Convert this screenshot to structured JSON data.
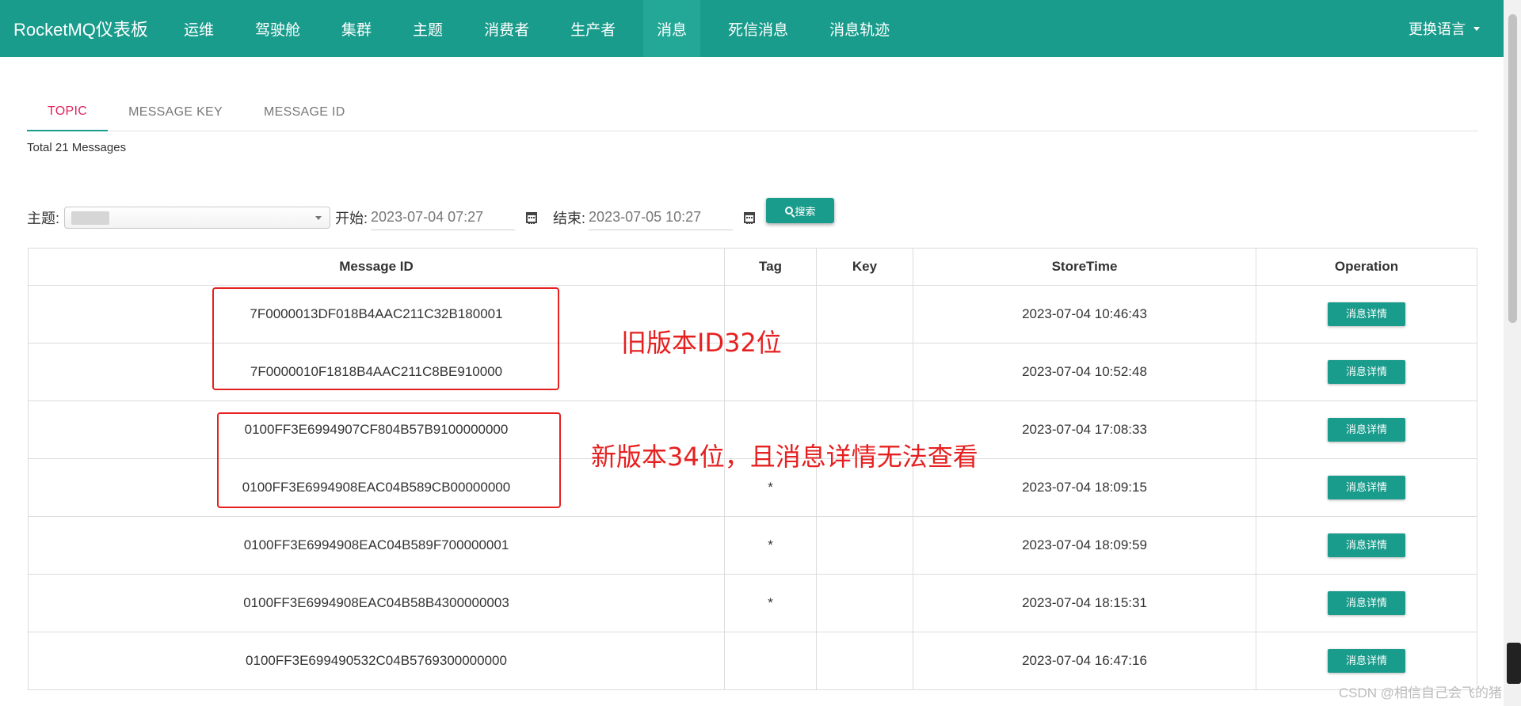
{
  "navbar": {
    "brand": "RocketMQ仪表板",
    "items": [
      "运维",
      "驾驶舱",
      "集群",
      "主题",
      "消费者",
      "生产者",
      "消息",
      "死信消息",
      "消息轨迹"
    ],
    "active_item": "消息",
    "language_label": "更换语言"
  },
  "tabs": [
    "TOPIC",
    "MESSAGE KEY",
    "MESSAGE ID"
  ],
  "active_tab": "TOPIC",
  "total_label": "Total 21 Messages",
  "filters": {
    "topic_label": "主题:",
    "start_label": "开始:",
    "start_value": "2023-07-04 07:27",
    "end_label": "结束:",
    "end_value": "2023-07-05 10:27",
    "search_label": "搜索"
  },
  "table": {
    "headers": [
      "Message ID",
      "Tag",
      "Key",
      "StoreTime",
      "Operation"
    ],
    "rows": [
      {
        "id": "7F0000013DF018B4AAC211C32B180001",
        "tag": "",
        "key": "",
        "time": "2023-07-04 10:46:43",
        "action": "消息详情"
      },
      {
        "id": "7F0000010F1818B4AAC211C8BE910000",
        "tag": "",
        "key": "",
        "time": "2023-07-04 10:52:48",
        "action": "消息详情"
      },
      {
        "id": "0100FF3E6994907CF804B57B9100000000",
        "tag": "",
        "key": "",
        "time": "2023-07-04 17:08:33",
        "action": "消息详情"
      },
      {
        "id": "0100FF3E6994908EAC04B589CB00000000",
        "tag": "*",
        "key": "",
        "time": "2023-07-04 18:09:15",
        "action": "消息详情"
      },
      {
        "id": "0100FF3E6994908EAC04B589F700000001",
        "tag": "*",
        "key": "",
        "time": "2023-07-04 18:09:59",
        "action": "消息详情"
      },
      {
        "id": "0100FF3E6994908EAC04B58B4300000003",
        "tag": "*",
        "key": "",
        "time": "2023-07-04 18:15:31",
        "action": "消息详情"
      },
      {
        "id": "0100FF3E699490532C04B5769300000000",
        "tag": "",
        "key": "",
        "time": "2023-07-04 16:47:16",
        "action": "消息详情"
      }
    ]
  },
  "annotations": {
    "old_version": "旧版本ID32位",
    "new_version": "新版本34位，且消息详情无法查看"
  },
  "watermark": "CSDN @相信自己会飞的猪",
  "colors": {
    "primary": "#1a9c8c",
    "active_tab_text": "#e0245e",
    "annotation": "#e62020"
  }
}
